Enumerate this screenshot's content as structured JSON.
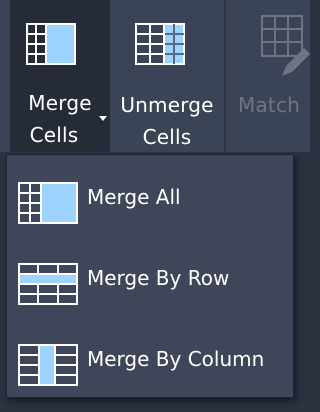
{
  "ribbon": {
    "merge_cells": {
      "line1": "Merge",
      "line2": "Cells"
    },
    "unmerge_cells": {
      "line1": "Unmerge",
      "line2": "Cells"
    },
    "match": {
      "label": "Match"
    }
  },
  "menu": {
    "items": [
      {
        "label": "Merge All",
        "icon": "merge-all-icon"
      },
      {
        "label": "Merge By Row",
        "icon": "merge-by-row-icon"
      },
      {
        "label": "Merge By Column",
        "icon": "merge-by-column-icon"
      }
    ]
  },
  "colors": {
    "accent_blue": "#9fd3ff",
    "grid_line": "#ffffff",
    "ribbon_bg": "#3b4456",
    "active_button_bg": "#252c38",
    "menu_bg": "#3f4659",
    "disabled_text": "#6d7585"
  }
}
